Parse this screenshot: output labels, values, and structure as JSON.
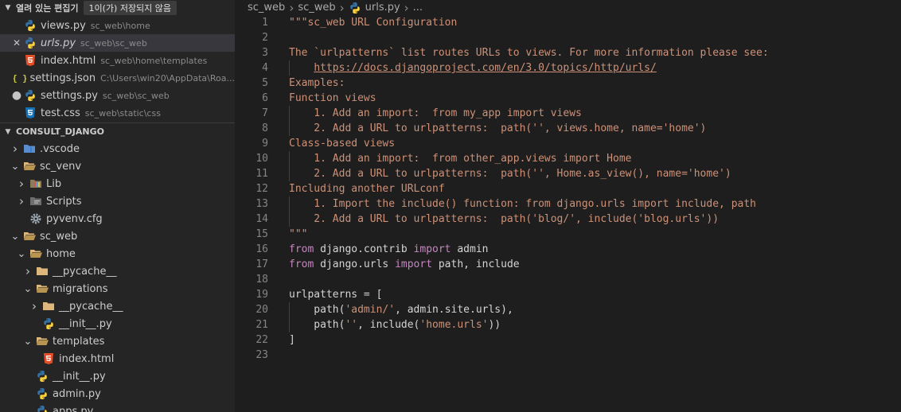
{
  "open_editors": {
    "title": "열려 있는 편집기",
    "badge": "1이(가) 저장되지 않음",
    "items": [
      {
        "name": "views.py",
        "desc": "sc_web\\home",
        "icon": "python-icon",
        "lead": "",
        "active": false,
        "italic": false
      },
      {
        "name": "urls.py",
        "desc": "sc_web\\sc_web",
        "icon": "python-icon",
        "lead": "close",
        "active": true,
        "italic": true
      },
      {
        "name": "index.html",
        "desc": "sc_web\\home\\templates",
        "icon": "html-icon",
        "lead": "",
        "active": false,
        "italic": false
      },
      {
        "name": "settings.json",
        "desc": "C:\\Users\\win20\\AppData\\Roa...",
        "icon": "json-icon",
        "lead": "",
        "active": false,
        "italic": false
      },
      {
        "name": "settings.py",
        "desc": "sc_web\\sc_web",
        "icon": "python-icon",
        "lead": "dot",
        "active": false,
        "italic": false
      },
      {
        "name": "test.css",
        "desc": "sc_web\\static\\css",
        "icon": "css-icon",
        "lead": "",
        "active": false,
        "italic": false
      }
    ]
  },
  "explorer": {
    "title": "CONSULT_DJANGO",
    "items": [
      {
        "name": ".vscode",
        "depth": 0,
        "twist": "closed",
        "icon": "vscode-folder-icon"
      },
      {
        "name": "sc_venv",
        "depth": 0,
        "twist": "open",
        "icon": "folder-open-icon"
      },
      {
        "name": "Lib",
        "depth": 1,
        "twist": "closed",
        "icon": "lib-folder-icon"
      },
      {
        "name": "Scripts",
        "depth": 1,
        "twist": "closed",
        "icon": "scripts-folder-icon"
      },
      {
        "name": "pyvenv.cfg",
        "depth": 1,
        "twist": "none",
        "icon": "gear-icon"
      },
      {
        "name": "sc_web",
        "depth": 0,
        "twist": "open",
        "icon": "folder-open-icon"
      },
      {
        "name": "home",
        "depth": 1,
        "twist": "open",
        "icon": "folder-open-icon"
      },
      {
        "name": "__pycache__",
        "depth": 2,
        "twist": "closed",
        "icon": "folder-icon"
      },
      {
        "name": "migrations",
        "depth": 2,
        "twist": "open",
        "icon": "folder-open-icon"
      },
      {
        "name": "__pycache__",
        "depth": 3,
        "twist": "closed",
        "icon": "folder-icon"
      },
      {
        "name": "__init__.py",
        "depth": 3,
        "twist": "none",
        "icon": "python-icon"
      },
      {
        "name": "templates",
        "depth": 2,
        "twist": "open",
        "icon": "folder-open-icon"
      },
      {
        "name": "index.html",
        "depth": 3,
        "twist": "none",
        "icon": "html-icon"
      },
      {
        "name": "__init__.py",
        "depth": 2,
        "twist": "none",
        "icon": "python-icon"
      },
      {
        "name": "admin.py",
        "depth": 2,
        "twist": "none",
        "icon": "python-icon"
      },
      {
        "name": "apps.py",
        "depth": 2,
        "twist": "none",
        "icon": "python-icon"
      }
    ]
  },
  "breadcrumbs": [
    "sc_web",
    "sc_web",
    "urls.py",
    "..."
  ],
  "code": {
    "lines": [
      {
        "n": "1",
        "guide": false,
        "tokens": [
          [
            "str",
            "\"\"\"sc_web URL Configuration"
          ]
        ]
      },
      {
        "n": "2",
        "guide": false,
        "tokens": []
      },
      {
        "n": "3",
        "guide": false,
        "tokens": [
          [
            "str",
            "The `urlpatterns` list routes URLs to views. For more information please see:"
          ]
        ]
      },
      {
        "n": "4",
        "guide": true,
        "tokens": [
          [
            "str",
            "    "
          ],
          [
            "link",
            "https://docs.djangoproject.com/en/3.0/topics/http/urls/"
          ]
        ]
      },
      {
        "n": "5",
        "guide": false,
        "tokens": [
          [
            "str",
            "Examples:"
          ]
        ]
      },
      {
        "n": "6",
        "guide": false,
        "tokens": [
          [
            "str",
            "Function views"
          ]
        ]
      },
      {
        "n": "7",
        "guide": true,
        "tokens": [
          [
            "str",
            "    1. Add an import:  from my_app import views"
          ]
        ]
      },
      {
        "n": "8",
        "guide": true,
        "tokens": [
          [
            "str",
            "    2. Add a URL to urlpatterns:  path('', views.home, name='home')"
          ]
        ]
      },
      {
        "n": "9",
        "guide": false,
        "tokens": [
          [
            "str",
            "Class-based views"
          ]
        ]
      },
      {
        "n": "10",
        "guide": true,
        "tokens": [
          [
            "str",
            "    1. Add an import:  from other_app.views import Home"
          ]
        ]
      },
      {
        "n": "11",
        "guide": true,
        "tokens": [
          [
            "str",
            "    2. Add a URL to urlpatterns:  path('', Home.as_view(), name='home')"
          ]
        ]
      },
      {
        "n": "12",
        "guide": false,
        "tokens": [
          [
            "str",
            "Including another URLconf"
          ]
        ]
      },
      {
        "n": "13",
        "guide": true,
        "tokens": [
          [
            "str",
            "    1. Import the include() function: from django.urls import include, path"
          ]
        ]
      },
      {
        "n": "14",
        "guide": true,
        "tokens": [
          [
            "str",
            "    2. Add a URL to urlpatterns:  path('blog/', include('blog.urls'))"
          ]
        ]
      },
      {
        "n": "15",
        "guide": false,
        "tokens": [
          [
            "str",
            "\"\"\""
          ]
        ]
      },
      {
        "n": "16",
        "guide": false,
        "tokens": [
          [
            "kw",
            "from"
          ],
          [
            "plain",
            " django.contrib "
          ],
          [
            "kw",
            "import"
          ],
          [
            "plain",
            " admin"
          ]
        ]
      },
      {
        "n": "17",
        "guide": false,
        "tokens": [
          [
            "kw",
            "from"
          ],
          [
            "plain",
            " django.urls "
          ],
          [
            "kw",
            "import"
          ],
          [
            "plain",
            " path, include"
          ]
        ]
      },
      {
        "n": "18",
        "guide": false,
        "tokens": []
      },
      {
        "n": "19",
        "guide": false,
        "tokens": [
          [
            "plain",
            "urlpatterns = ["
          ]
        ]
      },
      {
        "n": "20",
        "guide": true,
        "tokens": [
          [
            "plain",
            "    path("
          ],
          [
            "str",
            "'admin/'"
          ],
          [
            "plain",
            ", admin.site.urls),"
          ]
        ]
      },
      {
        "n": "21",
        "guide": true,
        "tokens": [
          [
            "plain",
            "    path("
          ],
          [
            "str",
            "''"
          ],
          [
            "plain",
            ", include("
          ],
          [
            "str",
            "'home.urls'"
          ],
          [
            "plain",
            "))"
          ]
        ]
      },
      {
        "n": "22",
        "guide": false,
        "tokens": [
          [
            "plain",
            "]"
          ]
        ]
      },
      {
        "n": "23",
        "guide": false,
        "tokens": []
      }
    ]
  },
  "colors": {
    "python_blue": "#3572a5",
    "python_yellow": "#ffd43b",
    "html_orange": "#e44d26",
    "css_blue": "#1572b6",
    "json_yellow": "#cbcb41",
    "folder_tan": "#dcb67a",
    "vscode_blue": "#2f80d1"
  }
}
